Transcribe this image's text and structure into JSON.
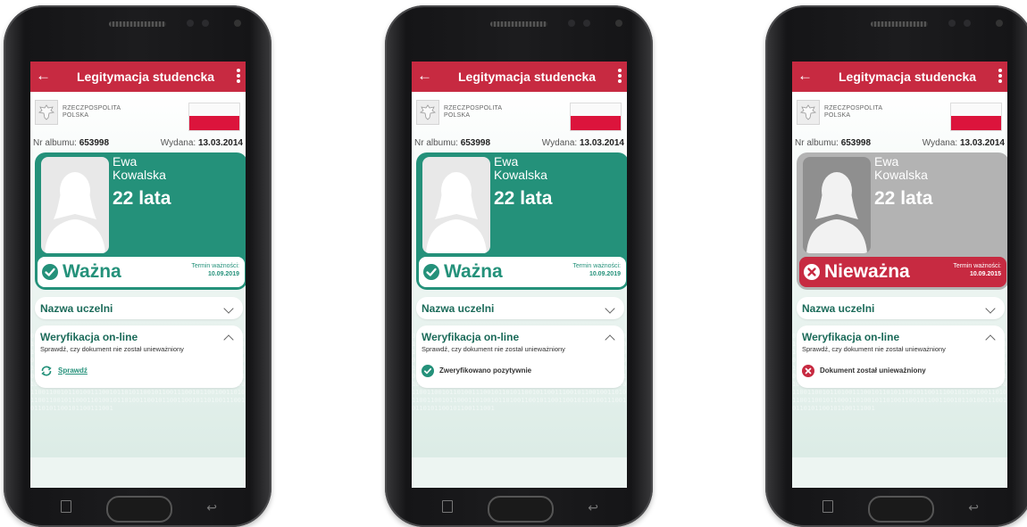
{
  "app": {
    "title": "Legitymacja studencka",
    "back_glyph": "←",
    "country_line1": "RZECZPOSPOLITA",
    "country_line2": "POLSKA"
  },
  "student": {
    "album_label": "Nr albumu:",
    "album_number": "653998",
    "issued_label": "Wydana:",
    "issued_date": "13.03.2014",
    "first_name": "Ewa",
    "last_name": "Kowalska",
    "age": "22 lata"
  },
  "term_label": "Termin ważności:",
  "university_label": "Nazwa uczelni",
  "verification": {
    "title": "Weryfikacja on-line",
    "description": "Sprawdź, czy dokument nie został unieważniony"
  },
  "screens": [
    {
      "status": "Ważna",
      "term_date": "10.09.2019",
      "action": "Sprawdź"
    },
    {
      "status": "Ważna",
      "term_date": "10.09.2019",
      "action": "Zweryfikowano pozytywnie"
    },
    {
      "status": "Nieważna",
      "term_date": "10.09.2015",
      "action": "Dokument został unieważniony"
    }
  ],
  "colors": {
    "brand_red": "#c72a41",
    "brand_green": "#24917a",
    "invalid_gray": "#b3b3b3",
    "flag_red": "#dc143c"
  },
  "icons": {
    "back": "arrow-left-icon",
    "menu": "more-vert-icon",
    "emblem": "eagle-emblem-icon",
    "valid": "check-circle-icon",
    "invalid": "x-circle-icon",
    "refresh": "refresh-icon",
    "expand": "chevron-icon"
  }
}
